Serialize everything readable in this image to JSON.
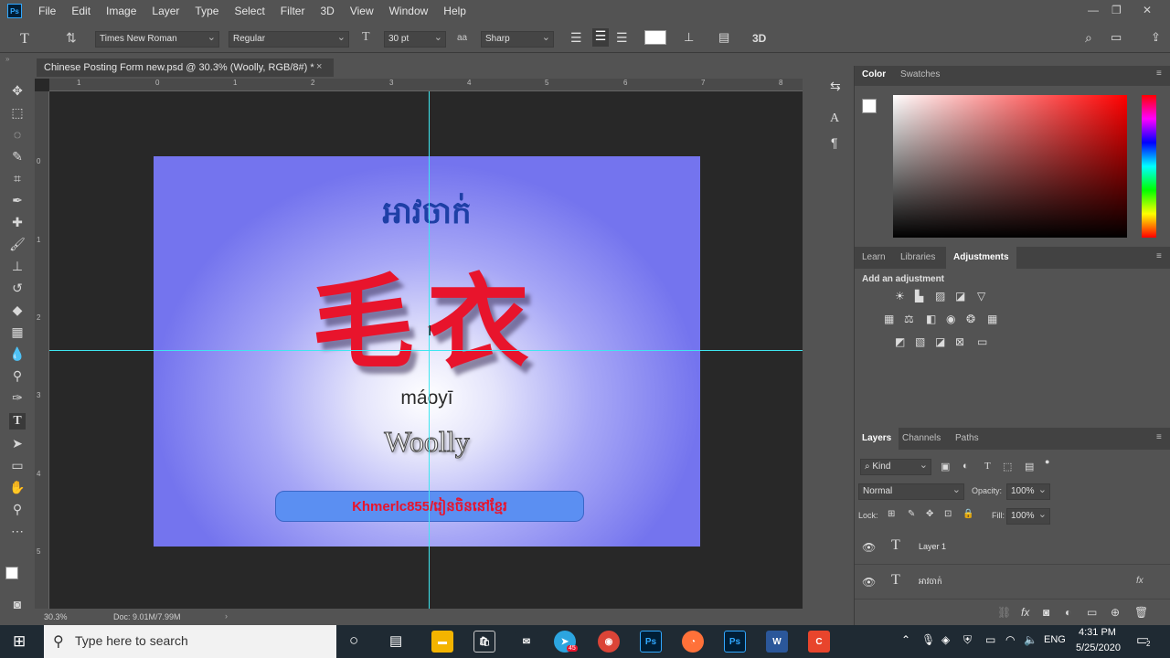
{
  "app": {
    "logo": "Ps"
  },
  "menu": [
    "File",
    "Edit",
    "Image",
    "Layer",
    "Type",
    "Select",
    "Filter",
    "3D",
    "View",
    "Window",
    "Help"
  ],
  "options": {
    "font_family": "Times New Roman",
    "font_style": "Regular",
    "font_size": "30 pt",
    "anti_alias_symbol": "aa",
    "anti_alias": "Sharp",
    "three_d": "3D",
    "tool_glyph": "T"
  },
  "document": {
    "tab_title": "Chinese Posting Form new.psd @ 30.3% (Woolly, RGB/8#) *",
    "close": "×",
    "zoom": "30.3%",
    "doc_size": "Doc: 9.01M/7.99M"
  },
  "rulers": {
    "h_ticks": [
      "1",
      "0",
      "1",
      "2",
      "3",
      "4",
      "5",
      "6",
      "7",
      "8"
    ],
    "v_ticks": [
      "0",
      "1",
      "2",
      "3",
      "4",
      "5"
    ]
  },
  "canvas": {
    "khmer_title": "អាវចាក់",
    "hanzi": "毛衣",
    "pinyin": "máoyī",
    "english": "Woolly",
    "banner": "Khmerlc855/រៀនចិននៅខ្មែរ"
  },
  "color_panel": {
    "tabs": [
      "Color",
      "Swatches"
    ],
    "active": "Color"
  },
  "adjust_panel": {
    "tabs": [
      "Learn",
      "Libraries",
      "Adjustments"
    ],
    "active": "Adjustments",
    "heading": "Add an adjustment"
  },
  "layers_panel": {
    "tabs": [
      "Layers",
      "Channels",
      "Paths"
    ],
    "active": "Layers",
    "kind": "Kind",
    "blend": "Normal",
    "opacity_label": "Opacity:",
    "opacity": "100%",
    "lock_label": "Lock:",
    "fill_label": "Fill:",
    "fill": "100%",
    "fx": "fx",
    "layers": [
      {
        "name": "Layer 1",
        "type": "T"
      },
      {
        "name": "អាវចាក់",
        "type": "T"
      }
    ]
  },
  "taskbar": {
    "search_placeholder": "Type here to search",
    "lang": "ENG",
    "time": "4:31 PM",
    "date": "5/25/2020",
    "notification_count": "2",
    "telegram_badge": "45",
    "apps": [
      "Ps",
      "Ps",
      "W"
    ]
  },
  "colors": {
    "accent": "#31a8ff",
    "guide": "#3ee6f0",
    "hanzi": "#e8142c",
    "khmer_title": "#1e3fa6",
    "banner": "#5b8ff2"
  }
}
